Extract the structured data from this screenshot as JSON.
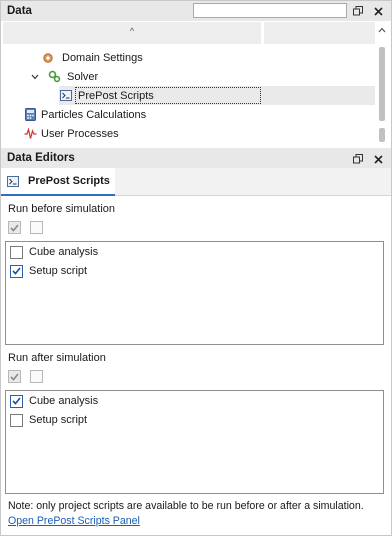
{
  "data_panel": {
    "title": "Data",
    "search": {
      "value": "",
      "placeholder": ""
    },
    "tree": [
      {
        "label": "Domain Settings",
        "icon": "domain-settings-icon"
      },
      {
        "label": "Solver",
        "icon": "solver-gears-icon",
        "expanded": true
      },
      {
        "label": "PrePost Scripts",
        "icon": "script-console-icon",
        "selected": true
      },
      {
        "label": "Particles Calculations",
        "icon": "particles-calculator-icon"
      },
      {
        "label": "User Processes",
        "icon": "user-processes-wave-icon"
      }
    ]
  },
  "editors_panel": {
    "title": "Data Editors",
    "tab": {
      "label": "PrePost Scripts",
      "icon": "script-console-icon"
    },
    "run_before": {
      "label": "Run before simulation",
      "items": [
        {
          "label": "Cube analysis",
          "checked": false
        },
        {
          "label": "Setup script",
          "checked": true
        }
      ]
    },
    "run_after": {
      "label": "Run after simulation",
      "items": [
        {
          "label": "Cube analysis",
          "checked": true
        },
        {
          "label": "Setup script",
          "checked": false
        }
      ]
    },
    "note": "Note: only project scripts are available to be run before or after a simulation.",
    "link": "Open PrePost Scripts Panel"
  },
  "colors": {
    "accent": "#2f6fc2",
    "link": "#1a5fb4",
    "header_bg": "#e8e8e8"
  }
}
